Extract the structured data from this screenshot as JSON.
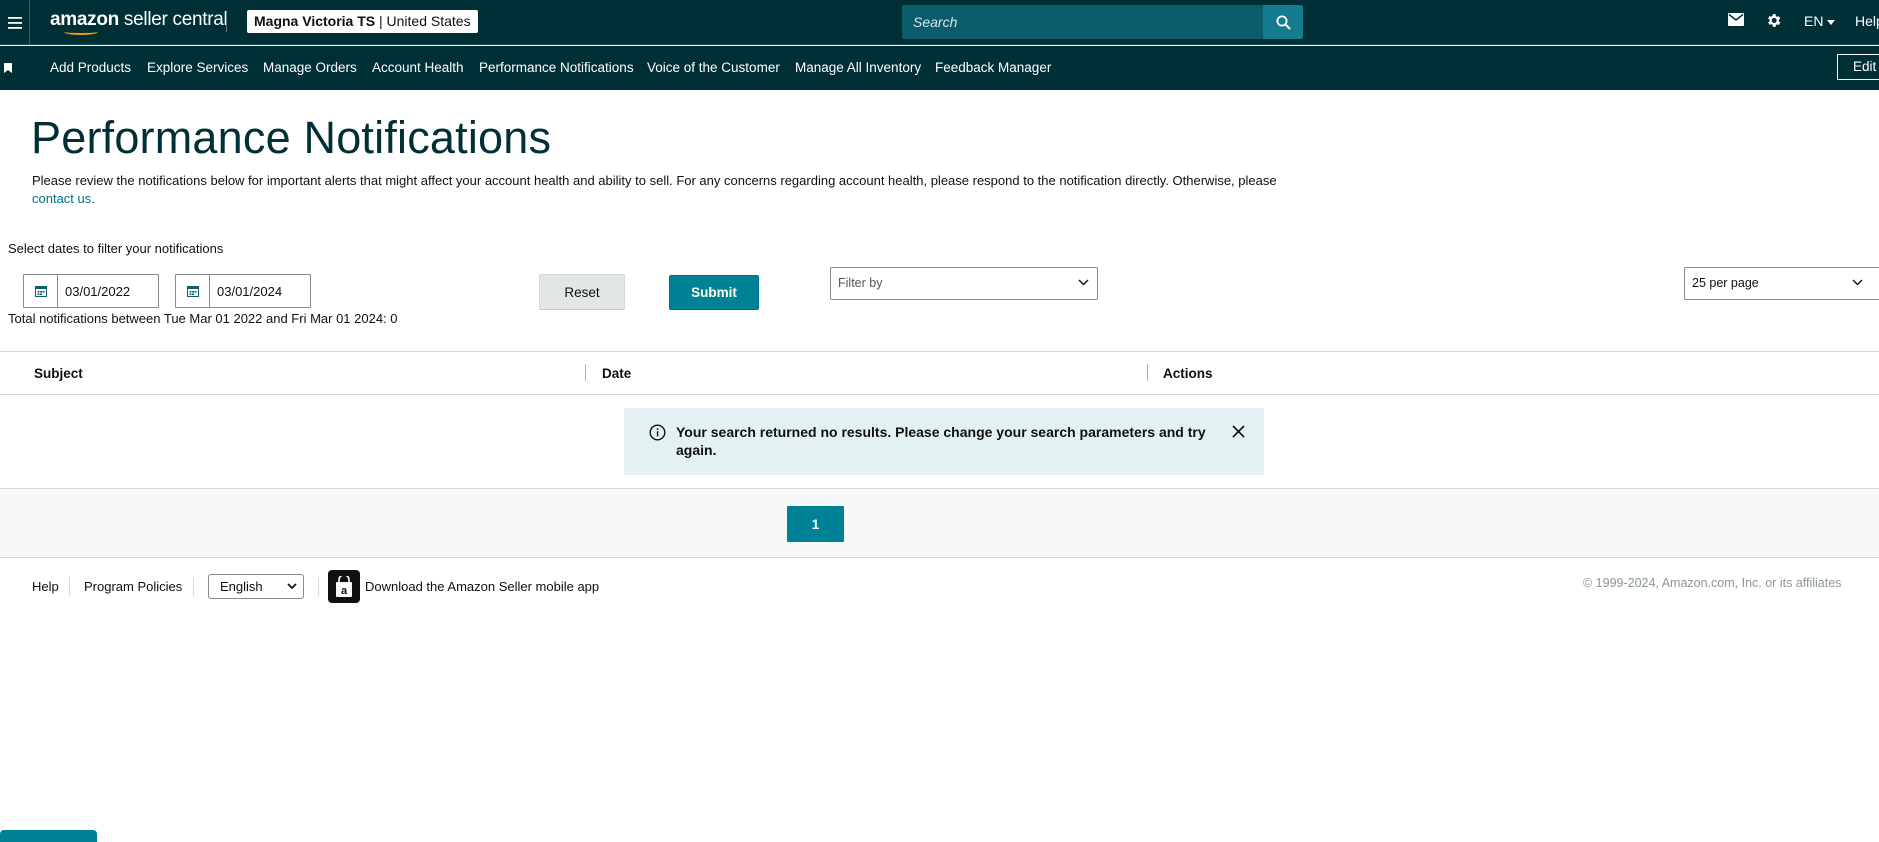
{
  "header": {
    "logo_text_bold": "amazon",
    "logo_text_rest": " seller central",
    "account_name": "Magna Victoria TS",
    "account_region": "United States",
    "search_placeholder": "Search",
    "language": "EN",
    "help_label": "Help"
  },
  "nav": {
    "items": [
      {
        "label": "Add Products"
      },
      {
        "label": "Explore Services"
      },
      {
        "label": "Manage Orders"
      },
      {
        "label": "Account Health"
      },
      {
        "label": "Performance Notifications"
      },
      {
        "label": "Voice of the Customer"
      },
      {
        "label": "Manage All Inventory"
      },
      {
        "label": "Feedback Manager"
      }
    ],
    "edit_label": "Edit"
  },
  "page": {
    "title": "Performance Notifications",
    "description_1": "Please review the notifications below for important alerts that might affect your account health and ability to sell. For any concerns regarding account health, please respond to the notification directly. Otherwise, please ",
    "contact_link": "contact us",
    "description_end": "."
  },
  "filters": {
    "label": "Select dates to filter your notifications",
    "start_date": "03/01/2022",
    "end_date": "03/01/2024",
    "reset_label": "Reset",
    "submit_label": "Submit",
    "filter_by_placeholder": "Filter by",
    "per_page": "25 per page",
    "total_text": "Total notifications between Tue Mar 01 2022 and Fri Mar 01 2024: 0"
  },
  "table": {
    "columns": [
      "Subject",
      "Date",
      "Actions"
    ],
    "empty_message": "Your search returned no results. Please change your search parameters and try again."
  },
  "pagination": {
    "current_page": "1"
  },
  "footer": {
    "help": "Help",
    "program_policies": "Program Policies",
    "language": "English",
    "app_download": "Download the Amazon Seller mobile app",
    "copyright": "© 1999-2024, Amazon.com, Inc. or its affiliates"
  },
  "colors": {
    "header_bg": "#002f36",
    "accent_teal": "#008296",
    "search_bg": "#0b5d6b",
    "alert_bg": "#e3f1f2"
  },
  "icons": [
    "hamburger-icon",
    "search-icon",
    "mail-icon",
    "gear-icon",
    "bookmark-icon",
    "calendar-icon",
    "chevron-down-icon",
    "info-icon",
    "close-icon",
    "amazon-app-icon"
  ]
}
